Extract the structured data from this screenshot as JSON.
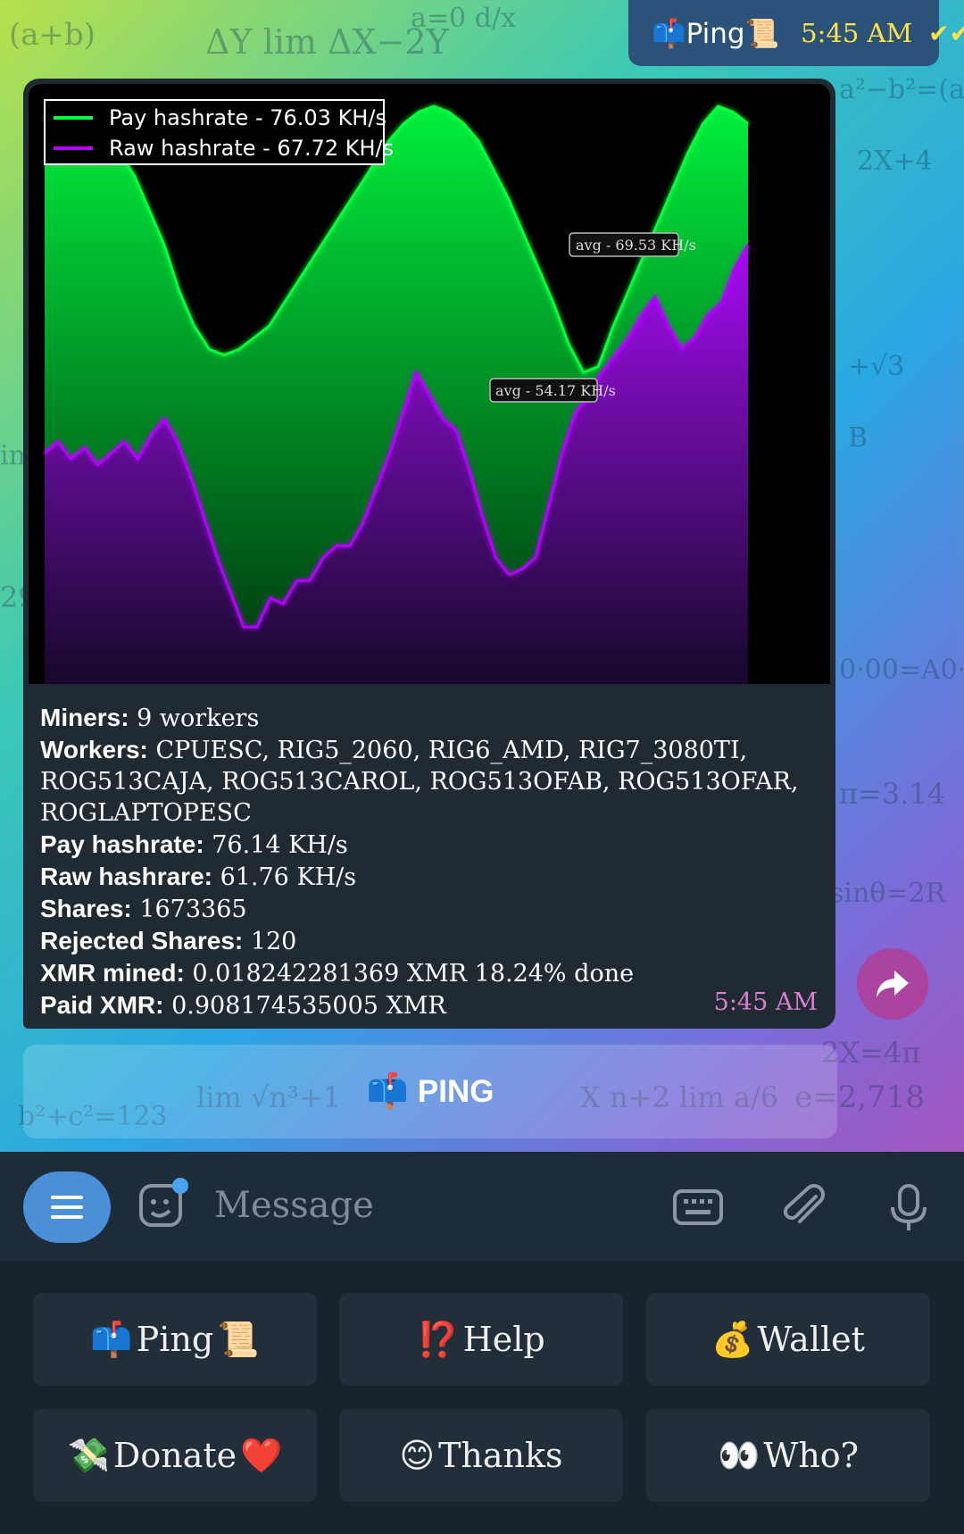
{
  "top_message": {
    "icon_left": "mailbox-icon",
    "label": "Ping",
    "icon_right": "scroll-icon",
    "time": "5:45 AM",
    "status": "read-double-check"
  },
  "chart_data": {
    "type": "area",
    "legend": [
      "Pay hashrate - 76.03 KH/s",
      "Raw  hashrate - 67.72 KH/s"
    ],
    "annotations": [
      "avg - 69.53 KH/s",
      "avg - 54.17 KH/s"
    ],
    "series": [
      {
        "name": "Pay hashrate - 76.03 KH/s",
        "color": "#00ff3c",
        "values": [
          96,
          95,
          94,
          93,
          92,
          90,
          86,
          80,
          74,
          66,
          60,
          56,
          55,
          56,
          58,
          60,
          64,
          68,
          72,
          76,
          80,
          84,
          88,
          92,
          95,
          97,
          98,
          97,
          95,
          92,
          87,
          82,
          76,
          70,
          64,
          57,
          52,
          53,
          60,
          66,
          72,
          78,
          84,
          90,
          95,
          98,
          97,
          95
        ]
      },
      {
        "name": "Raw  hashrate - 67.72 KH/s",
        "color": "#b400ff",
        "values": [
          38,
          40,
          37,
          39,
          36,
          38,
          40,
          37,
          41,
          44,
          40,
          34,
          27,
          20,
          14,
          8,
          8,
          13,
          12,
          16,
          16,
          20,
          22,
          22,
          26,
          32,
          38,
          45,
          52,
          48,
          44,
          42,
          35,
          27,
          20,
          17,
          18,
          20,
          29,
          38,
          45,
          48,
          52,
          55,
          58,
          62,
          65,
          60,
          56,
          58,
          62,
          64,
          70,
          74
        ]
      }
    ]
  },
  "message": {
    "lines": [
      {
        "label": "Miners:",
        "value": "9 workers"
      },
      {
        "label": "Workers:",
        "value": "CPUESC, RIG5_2060, RIG6_AMD, RIG7_3080TI, ROG513CAJA, ROG513CAROL, ROG513OFAB, ROG513OFAR, ROGLAPTOPESC"
      },
      {
        "label": "Pay hashrate:",
        "value": "76.14 KH/s"
      },
      {
        "label": "Raw hashrare:",
        "value": "61.76 KH/s"
      },
      {
        "label": "Shares:",
        "value": "1673365"
      },
      {
        "label": "Rejected Shares:",
        "value": "120"
      },
      {
        "label": "XMR mined:",
        "value": "0.018242281369 XMR 18.24% done"
      },
      {
        "label": "Paid XMR:",
        "value": "0.908174535005 XMR"
      }
    ],
    "time": "5:45 AM"
  },
  "inline_button": {
    "icon": "mailbox-icon",
    "label": "PING"
  },
  "input": {
    "placeholder": "Message"
  },
  "keyboard": {
    "buttons": [
      {
        "prefix": "📫",
        "label": "Ping",
        "suffix": "📜"
      },
      {
        "prefix": "⁉️",
        "label": "Help",
        "suffix": ""
      },
      {
        "prefix": "💰",
        "label": "Wallet",
        "suffix": ""
      },
      {
        "prefix": "💸",
        "label": "Donate",
        "suffix": "❤️"
      },
      {
        "prefix": "😊",
        "label": "Thanks",
        "suffix": ""
      },
      {
        "prefix": "👀",
        "label": "Who?",
        "suffix": ""
      }
    ]
  }
}
